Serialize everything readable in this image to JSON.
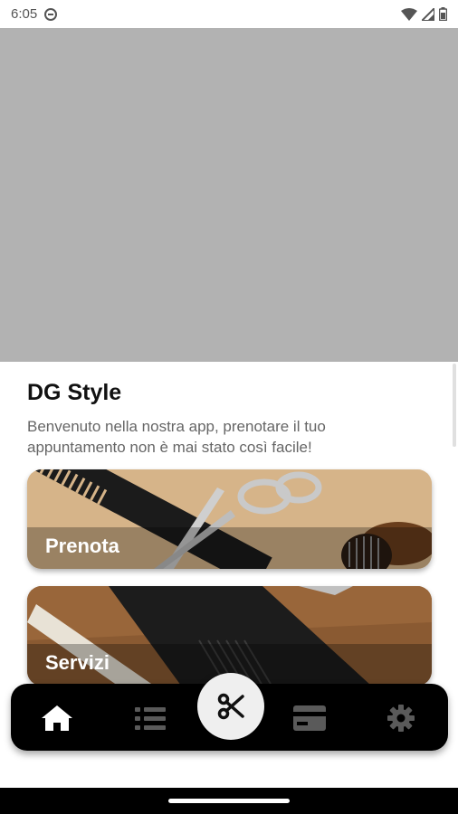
{
  "status_bar": {
    "time": "6:05",
    "icons": [
      "do-not-disturb-icon",
      "wifi-icon",
      "signal-icon",
      "battery-icon"
    ]
  },
  "hero": {
    "image": "header-placeholder"
  },
  "header": {
    "title": "DG Style",
    "subtitle": "Benvenuto nella nostra app, prenotare il tuo appuntamento non è mai stato così facile!"
  },
  "cards": [
    {
      "label": "Prenota",
      "image": "scissors-comb-photo"
    },
    {
      "label": "Servizi",
      "image": "comb-wood-photo"
    }
  ],
  "nav": {
    "items": [
      {
        "icon": "home-icon",
        "active": true
      },
      {
        "icon": "list-icon",
        "active": false
      },
      {
        "icon": "scissors-icon",
        "active": false,
        "center": true
      },
      {
        "icon": "card-icon",
        "active": false
      },
      {
        "icon": "gear-icon",
        "active": false
      }
    ],
    "colors": {
      "active": "#ffffff",
      "inactive": "#5a5a5a",
      "bar": "#000000",
      "fab": "#efefef"
    }
  }
}
